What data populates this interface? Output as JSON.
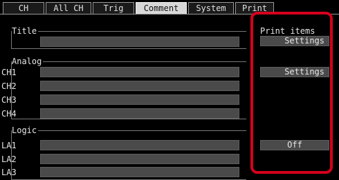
{
  "tabs": {
    "ch": "CH",
    "all_ch": "All CH",
    "trig": "Trig",
    "comment": "Comment",
    "system": "System",
    "print": "Print"
  },
  "title_group": {
    "legend": "Title"
  },
  "analog_group": {
    "legend": "Analog",
    "rows": [
      "CH1",
      "CH2",
      "CH3",
      "CH4"
    ]
  },
  "logic_group": {
    "legend": "Logic",
    "rows": [
      "LA1",
      "LA2",
      "LA3"
    ]
  },
  "right": {
    "title": "Print items",
    "settings_1": "Settings",
    "settings_2": "Settings",
    "off": "Off"
  },
  "colors": {
    "background": "#000000",
    "field": "#4a4a4a",
    "active_tab": "#d8d8d8",
    "highlight": "#d6001c"
  }
}
